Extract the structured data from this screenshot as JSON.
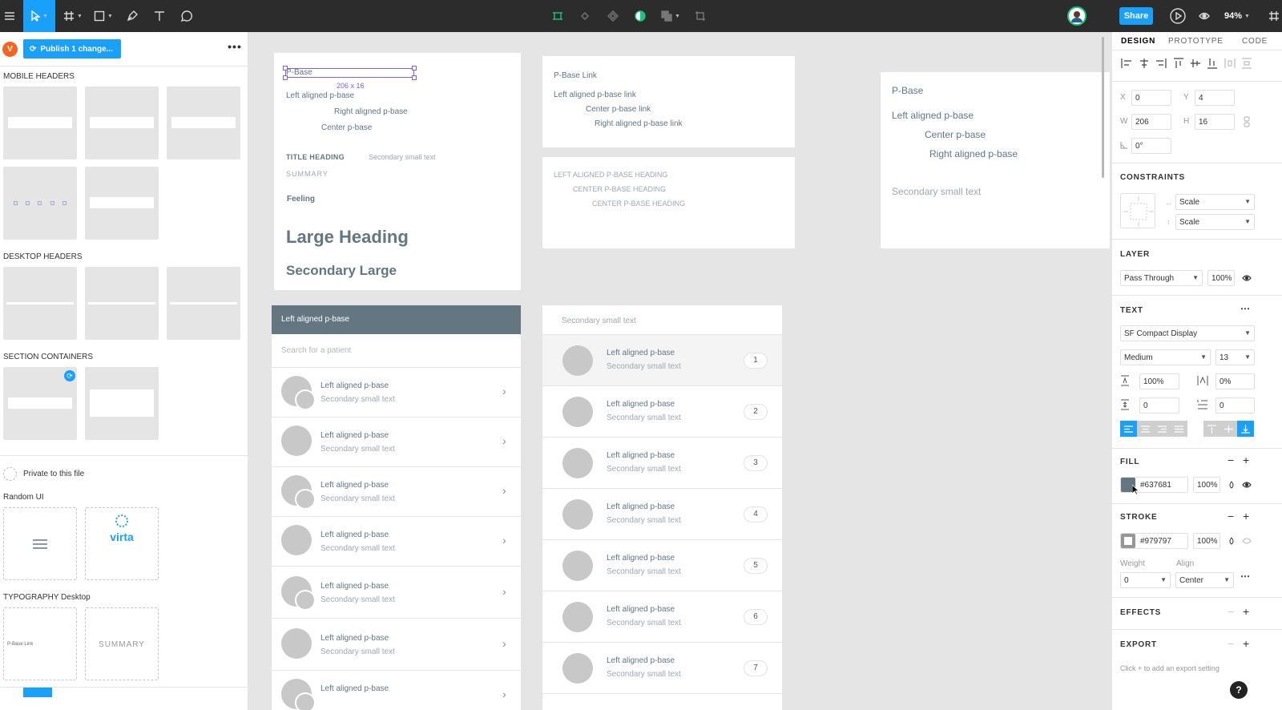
{
  "toolbar": {
    "zoom": "94%",
    "share_label": "Share"
  },
  "left_panel": {
    "avatar_initial": "V",
    "publish_label": "Publish 1 change...",
    "more_label": "•••",
    "sections": {
      "mobile_headers": "MOBILE HEADERS",
      "desktop_headers": "DESKTOP HEADERS",
      "section_containers": "SECTION CONTAINERS",
      "random_ui": "Random UI",
      "typography_desktop": "TYPOGRAPHY Desktop"
    },
    "private_label": "Private to this file",
    "virta_label": "virta",
    "typo_thumb_link": "P-Base Link",
    "typo_thumb_summary": "SUMMARY"
  },
  "canvas": {
    "frame1": {
      "p_base": "P-Base",
      "size_label": "206 x 16",
      "left_aligned": "Left aligned p-base",
      "right_aligned": "Right aligned p-base",
      "center": "Center p-base",
      "title_heading": "TITLE HEADING",
      "secondary_small": "Secondary small text",
      "summary": "SUMMARY",
      "feeling": "Feeling",
      "large_heading": "Large Heading",
      "secondary_large": "Secondary Large"
    },
    "frame2": {
      "link": "P-Base Link",
      "left_link": "Left aligned p-base link",
      "center_link": "Center p-base link",
      "right_link": "Right aligned p-base link"
    },
    "frame3": {
      "left_heading": "LEFT ALIGNED P-BASE HEADING",
      "center_heading1": "CENTER P-BASE HEADING",
      "center_heading2": "CENTER P-BASE HEADING"
    },
    "frame4": {
      "p_base": "P-Base",
      "left_aligned": "Left aligned p-base",
      "center": "Center p-base",
      "right_aligned": "Right aligned p-base",
      "secondary_small": "Secondary small text"
    },
    "patient_list": {
      "header": "Left aligned p-base",
      "search_placeholder": "Search for a patient",
      "rows": [
        {
          "title": "Left aligned p-base",
          "sub": "Secondary small text"
        },
        {
          "title": "Left aligned p-base",
          "sub": "Secondary small text"
        },
        {
          "title": "Left aligned p-base",
          "sub": "Secondary small text"
        },
        {
          "title": "Left aligned p-base",
          "sub": "Secondary small text"
        },
        {
          "title": "Left aligned p-base",
          "sub": "Secondary small text"
        },
        {
          "title": "Left aligned p-base",
          "sub": "Secondary small text"
        },
        {
          "title": "Left aligned p-base",
          "sub": ""
        }
      ]
    },
    "numbered_list": {
      "header": "Secondary small text",
      "rows": [
        {
          "title": "Left aligned p-base",
          "sub": "Secondary small text",
          "num": "1"
        },
        {
          "title": "Left aligned p-base",
          "sub": "Secondary small text",
          "num": "2"
        },
        {
          "title": "Left aligned p-base",
          "sub": "Secondary small text",
          "num": "3"
        },
        {
          "title": "Left aligned p-base",
          "sub": "Secondary small text",
          "num": "4"
        },
        {
          "title": "Left aligned p-base",
          "sub": "Secondary small text",
          "num": "5"
        },
        {
          "title": "Left aligned p-base",
          "sub": "Secondary small text",
          "num": "6"
        },
        {
          "title": "Left aligned p-base",
          "sub": "Secondary small text",
          "num": "7"
        }
      ]
    }
  },
  "right_panel": {
    "tabs": {
      "design": "DESIGN",
      "prototype": "PROTOTYPE",
      "code": "CODE"
    },
    "x_label": "X",
    "x": "0",
    "y_label": "Y",
    "y": "4",
    "w_label": "W",
    "w": "206",
    "h_label": "H",
    "h": "16",
    "rotation": "0°",
    "constraints_title": "CONSTRAINTS",
    "constraint_h": "Scale",
    "constraint_v": "Scale",
    "layer_title": "LAYER",
    "blend_mode": "Pass Through",
    "layer_opacity": "100%",
    "text_title": "TEXT",
    "font_family": "SF Compact Display",
    "font_weight": "Medium",
    "font_size": "13",
    "line_height": "100%",
    "letter_spacing": "0%",
    "paragraph_spacing": "0",
    "paragraph_indent": "0",
    "fill_title": "FILL",
    "fill_hex": "#637681",
    "fill_opacity": "100%",
    "stroke_title": "STROKE",
    "stroke_hex": "#979797",
    "stroke_opacity": "100%",
    "weight_label": "Weight",
    "align_label": "Align",
    "stroke_weight": "0",
    "stroke_align": "Center",
    "effects_title": "EFFECTS",
    "export_title": "EXPORT",
    "export_hint": "Click + to add an export setting",
    "help": "?"
  },
  "colors": {
    "accent": "#18a0fb",
    "toolbar_bg": "#2c2c2c",
    "text_blue_gray": "#637681",
    "stroke_gray": "#979797",
    "selection": "#7b61ff"
  }
}
